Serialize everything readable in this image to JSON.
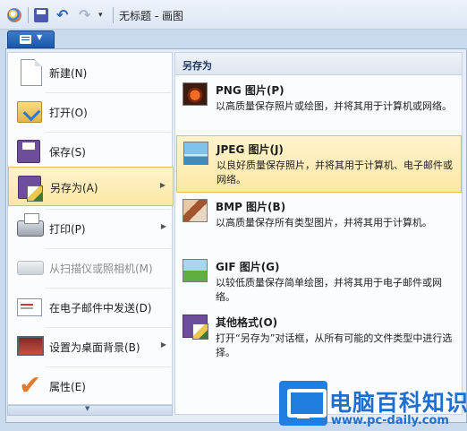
{
  "window": {
    "title": "无标题 - 画图"
  },
  "app_menu": {
    "items": [
      {
        "label": "新建(N)",
        "icon": "new-doc-icon"
      },
      {
        "label": "打开(O)",
        "icon": "open-folder-icon"
      },
      {
        "label": "保存(S)",
        "icon": "save-disk-icon"
      },
      {
        "label": "另存为(A)",
        "icon": "save-as-icon",
        "has_submenu": true,
        "highlighted": true
      },
      {
        "label": "打印(P)",
        "icon": "printer-icon",
        "has_submenu": true
      },
      {
        "label": "从扫描仪或照相机(M)",
        "icon": "scanner-icon",
        "disabled": true
      },
      {
        "label": "在电子邮件中发送(D)",
        "icon": "email-icon"
      },
      {
        "label": "设置为桌面背景(B)",
        "icon": "desktop-background-icon",
        "has_submenu": true
      },
      {
        "label": "属性(E)",
        "icon": "properties-check-icon"
      }
    ]
  },
  "submenu": {
    "title": "另存为",
    "items": [
      {
        "title": "PNG 图片(P)",
        "desc": "以高质量保存照片或绘图，并将其用于计算机或网络。",
        "icon": "png-image-icon"
      },
      {
        "title": "JPEG 图片(J)",
        "desc": "以良好质量保存照片，并将其用于计算机、电子邮件或网络。",
        "icon": "jpeg-image-icon",
        "highlighted": true
      },
      {
        "title": "BMP 图片(B)",
        "desc": "以高质量保存所有类型图片，并将其用于计算机。",
        "icon": "bmp-image-icon"
      },
      {
        "title": "GIF 图片(G)",
        "desc": "以较低质量保存简单绘图，并将其用于电子邮件或网络。",
        "icon": "gif-image-icon"
      },
      {
        "title": "其他格式(O)",
        "desc": "打开“另存为”对话框，从所有可能的文件类型中进行选择。",
        "icon": "other-formats-icon"
      }
    ]
  },
  "watermark": {
    "name": "电脑百科知识",
    "url": "www.pc-daily.com"
  }
}
